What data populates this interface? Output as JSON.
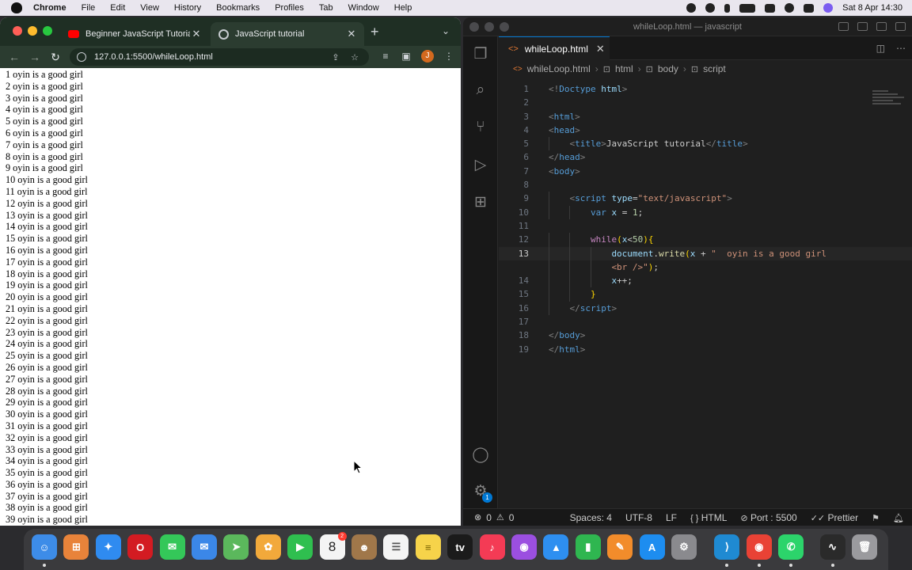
{
  "menubar": {
    "app": "Chrome",
    "items": [
      "File",
      "Edit",
      "View",
      "History",
      "Bookmarks",
      "Profiles",
      "Tab",
      "Window",
      "Help"
    ],
    "clock": "Sat 8 Apr  14:30"
  },
  "chrome": {
    "tabs": [
      {
        "title": "Beginner JavaScript Tutorial -",
        "icon": "youtube-icon",
        "active": false
      },
      {
        "title": "JavaScript tutorial",
        "icon": "globe-icon",
        "active": true
      }
    ],
    "url": "127.0.0.1:5500/whileLoop.html",
    "profile_initial": "J",
    "output_lines": [
      "1 oyin is a good girl",
      "2 oyin is a good girl",
      "3 oyin is a good girl",
      "4 oyin is a good girl",
      "5 oyin is a good girl",
      "6 oyin is a good girl",
      "7 oyin is a good girl",
      "8 oyin is a good girl",
      "9 oyin is a good girl",
      "10 oyin is a good girl",
      "11 oyin is a good girl",
      "12 oyin is a good girl",
      "13 oyin is a good girl",
      "14 oyin is a good girl",
      "15 oyin is a good girl",
      "16 oyin is a good girl",
      "17 oyin is a good girl",
      "18 oyin is a good girl",
      "19 oyin is a good girl",
      "20 oyin is a good girl",
      "21 oyin is a good girl",
      "22 oyin is a good girl",
      "23 oyin is a good girl",
      "24 oyin is a good girl",
      "25 oyin is a good girl",
      "26 oyin is a good girl",
      "27 oyin is a good girl",
      "28 oyin is a good girl",
      "29 oyin is a good girl",
      "30 oyin is a good girl",
      "31 oyin is a good girl",
      "32 oyin is a good girl",
      "33 oyin is a good girl",
      "34 oyin is a good girl",
      "35 oyin is a good girl",
      "36 oyin is a good girl",
      "37 oyin is a good girl",
      "38 oyin is a good girl",
      "39 oyin is a good girl"
    ]
  },
  "vscode": {
    "window_title": "whileLoop.html — javascript",
    "tab": "whileLoop.html",
    "breadcrumb": [
      "whileLoop.html",
      "html",
      "body",
      "script"
    ],
    "status": {
      "errors": "0",
      "warnings": "0",
      "spaces": "Spaces: 4",
      "encoding": "UTF-8",
      "eol": "LF",
      "language": "HTML",
      "port": "Port : 5500",
      "formatter": "Prettier"
    },
    "extensions_badge": "1"
  },
  "code_lines": [
    {
      "n": "1",
      "indent": 0,
      "tokens": [
        [
          "tk-tag",
          "<!"
        ],
        [
          "tk-doc",
          "Doctype"
        ],
        [
          "tk-attr",
          " html"
        ],
        [
          "tk-tag",
          ">"
        ]
      ]
    },
    {
      "n": "2",
      "indent": 0,
      "tokens": []
    },
    {
      "n": "3",
      "indent": 0,
      "tokens": [
        [
          "tk-tag",
          "<"
        ],
        [
          "tk-name",
          "html"
        ],
        [
          "tk-tag",
          ">"
        ]
      ]
    },
    {
      "n": "4",
      "indent": 0,
      "tokens": [
        [
          "tk-tag",
          "<"
        ],
        [
          "tk-name",
          "head"
        ],
        [
          "tk-tag",
          ">"
        ]
      ]
    },
    {
      "n": "5",
      "indent": 1,
      "tokens": [
        [
          "tk-tag",
          "<"
        ],
        [
          "tk-name",
          "title"
        ],
        [
          "tk-tag",
          ">"
        ],
        [
          "",
          "JavaScript tutorial"
        ],
        [
          "tk-tag",
          "</"
        ],
        [
          "tk-name",
          "title"
        ],
        [
          "tk-tag",
          ">"
        ]
      ]
    },
    {
      "n": "6",
      "indent": 0,
      "tokens": [
        [
          "tk-tag",
          "</"
        ],
        [
          "tk-name",
          "head"
        ],
        [
          "tk-tag",
          ">"
        ]
      ]
    },
    {
      "n": "7",
      "indent": 0,
      "tokens": [
        [
          "tk-tag",
          "<"
        ],
        [
          "tk-name",
          "body"
        ],
        [
          "tk-tag",
          ">"
        ]
      ]
    },
    {
      "n": "8",
      "indent": 0,
      "tokens": []
    },
    {
      "n": "9",
      "indent": 1,
      "tokens": [
        [
          "tk-tag",
          "<"
        ],
        [
          "tk-name",
          "script"
        ],
        [
          "tk-attr",
          " type"
        ],
        [
          "",
          "="
        ],
        [
          "tk-str",
          "\"text/javascript\""
        ],
        [
          "tk-tag",
          ">"
        ]
      ]
    },
    {
      "n": "10",
      "indent": 2,
      "tokens": [
        [
          "tk-kw",
          "var"
        ],
        [
          "tk-var",
          " x"
        ],
        [
          "",
          " = "
        ],
        [
          "tk-num",
          "1"
        ],
        [
          "",
          ";"
        ]
      ]
    },
    {
      "n": "11",
      "indent": 0,
      "tokens": []
    },
    {
      "n": "12",
      "indent": 2,
      "tokens": [
        [
          "tk-ctrl",
          "while"
        ],
        [
          "tk-brace",
          "("
        ],
        [
          "tk-var",
          "x"
        ],
        [
          "",
          "<"
        ],
        [
          "tk-num",
          "50"
        ],
        [
          "tk-brace",
          "){"
        ]
      ]
    },
    {
      "n": "13",
      "indent": 3,
      "active": true,
      "tokens": [
        [
          "tk-var",
          "document"
        ],
        [
          "",
          "."
        ],
        [
          "tk-fn",
          "write"
        ],
        [
          "tk-brace",
          "("
        ],
        [
          "tk-var",
          "x"
        ],
        [
          "",
          " + "
        ],
        [
          "tk-str",
          "\"  oyin is a good girl"
        ]
      ]
    },
    {
      "n": "",
      "indent": 3,
      "tokens": [
        [
          "tk-str",
          "<br />\""
        ],
        [
          "tk-brace",
          ")"
        ],
        [
          "",
          ";"
        ]
      ]
    },
    {
      "n": "14",
      "indent": 3,
      "tokens": [
        [
          "tk-var",
          "x"
        ],
        [
          "",
          "++;"
        ]
      ]
    },
    {
      "n": "15",
      "indent": 2,
      "tokens": [
        [
          "tk-brace",
          "}"
        ]
      ]
    },
    {
      "n": "16",
      "indent": 1,
      "tokens": [
        [
          "tk-tag",
          "</"
        ],
        [
          "tk-name",
          "script"
        ],
        [
          "tk-tag",
          ">"
        ]
      ]
    },
    {
      "n": "17",
      "indent": 0,
      "tokens": []
    },
    {
      "n": "18",
      "indent": 0,
      "tokens": [
        [
          "tk-tag",
          "</"
        ],
        [
          "tk-name",
          "body"
        ],
        [
          "tk-tag",
          ">"
        ]
      ]
    },
    {
      "n": "19",
      "indent": 0,
      "tokens": [
        [
          "tk-tag",
          "</"
        ],
        [
          "tk-name",
          "html"
        ],
        [
          "tk-tag",
          ">"
        ]
      ]
    }
  ],
  "dock": {
    "calendar_day": "8",
    "calendar_badge": "2",
    "apps": [
      {
        "name": "finder-icon",
        "color": "#3d8ce8"
      },
      {
        "name": "launchpad-icon",
        "color": "#e8833a"
      },
      {
        "name": "safari-icon",
        "color": "#2f8bf0"
      },
      {
        "name": "opera-icon",
        "color": "#d31b22"
      },
      {
        "name": "messages-icon",
        "color": "#34c759"
      },
      {
        "name": "mail-icon",
        "color": "#3b87e8"
      },
      {
        "name": "maps-icon",
        "color": "#5bb85c"
      },
      {
        "name": "photos-icon",
        "color": "#f2a93b"
      },
      {
        "name": "facetime-icon",
        "color": "#2fbf4f"
      },
      {
        "name": "calendar-icon",
        "color": "#f4f4f4"
      },
      {
        "name": "contacts-icon",
        "color": "#a0774a"
      },
      {
        "name": "reminders-icon",
        "color": "#f4f4f4"
      },
      {
        "name": "notes-icon",
        "color": "#f6d34a"
      },
      {
        "name": "apple-tv-icon",
        "color": "#1b1b1b"
      },
      {
        "name": "music-icon",
        "color": "#f43b55"
      },
      {
        "name": "podcasts-icon",
        "color": "#9b4fe0"
      },
      {
        "name": "keynote-icon",
        "color": "#2e8ff0"
      },
      {
        "name": "numbers-icon",
        "color": "#2fb650"
      },
      {
        "name": "pages-icon",
        "color": "#f28c2b"
      },
      {
        "name": "app-store-icon",
        "color": "#1d8df0"
      },
      {
        "name": "system-settings-icon",
        "color": "#8a8a8e"
      },
      {
        "name": "vscode-icon",
        "color": "#1f8ad2"
      },
      {
        "name": "chrome-icon",
        "color": "#e94235"
      },
      {
        "name": "whatsapp-icon",
        "color": "#2cd46b"
      },
      {
        "name": "activity-monitor-icon",
        "color": "#2a2a2a"
      },
      {
        "name": "trash-icon",
        "color": "#9a9a9e"
      }
    ]
  }
}
